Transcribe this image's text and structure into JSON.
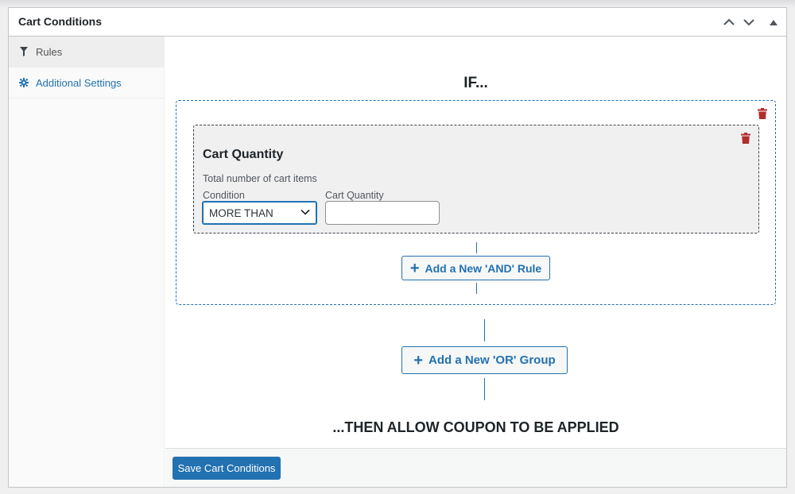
{
  "panel": {
    "title": "Cart Conditions"
  },
  "header_controls": [
    {
      "name": "move-up",
      "icon": "chevron-up-icon"
    },
    {
      "name": "move-down",
      "icon": "chevron-down-icon"
    },
    {
      "name": "toggle-panel",
      "icon": "triangle-up-icon"
    }
  ],
  "sidebar": {
    "items": [
      {
        "label": "Rules",
        "icon": "filter-icon",
        "active": true
      },
      {
        "label": "Additional Settings",
        "icon": "gear-icon",
        "active": false
      }
    ]
  },
  "main": {
    "if_label": "IF...",
    "rule": {
      "title": "Cart Quantity",
      "description": "Total number of cart items",
      "condition_label": "Condition",
      "condition_value": "MORE THAN",
      "quantity_label": "Cart Quantity",
      "quantity_value": ""
    },
    "add_and_rule_label": "Add a New 'AND' Rule",
    "add_or_group_label": "Add a New 'OR' Group",
    "then_label": "...THEN ALLOW COUPON TO BE APPLIED"
  },
  "footer": {
    "save_label": "Save Cart Conditions"
  },
  "colors": {
    "accent": "#2271b1",
    "delete": "#b32d2e",
    "rule_bg": "#f0f0f1"
  }
}
